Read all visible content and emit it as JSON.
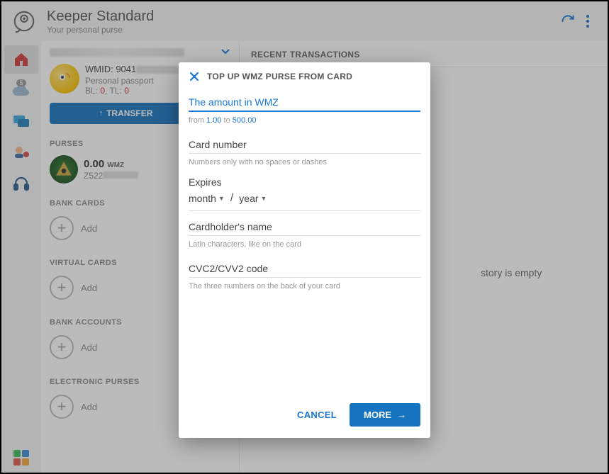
{
  "header": {
    "title": "Keeper Standard",
    "subtitle": "Your personal purse"
  },
  "rail": {
    "badge": "5"
  },
  "identity": {
    "wmid_label": "WMID: 9041",
    "passport": "Personal passport",
    "bl_label": "BL:",
    "bl_value": "0",
    "tl_label": "TL:",
    "tl_value": "0"
  },
  "buttons": {
    "transfer": "TRANSFER"
  },
  "sections": {
    "purses": "PURSES",
    "bank_cards": "BANK CARDS",
    "virtual_cards": "VIRTUAL CARDS",
    "bank_accounts": "BANK ACCOUNTS",
    "electronic_purses": "ELECTRONIC PURSES"
  },
  "purse": {
    "amount": "0.00",
    "currency": "WMZ",
    "account_prefix": "Z522"
  },
  "add_label": "Add",
  "right": {
    "heading": "RECENT TRANSACTIONS",
    "empty_suffix": "story is empty"
  },
  "modal": {
    "title": "TOP UP WMZ PURSE FROM CARD",
    "amount_label": "The amount in WMZ",
    "range_from": "from",
    "range_min": "1.00",
    "range_to": "to",
    "range_max": "500.00",
    "card_number": "Card number",
    "card_hint": "Numbers only with no spaces or dashes",
    "expires": "Expires",
    "month": "month",
    "year": "year",
    "holder": "Cardholder's name",
    "holder_hint": "Latin characters, like on the card",
    "cvv": "CVC2/CVV2 code",
    "cvv_hint": "The three numbers on the back of your card",
    "cancel": "CANCEL",
    "more": "MORE"
  }
}
